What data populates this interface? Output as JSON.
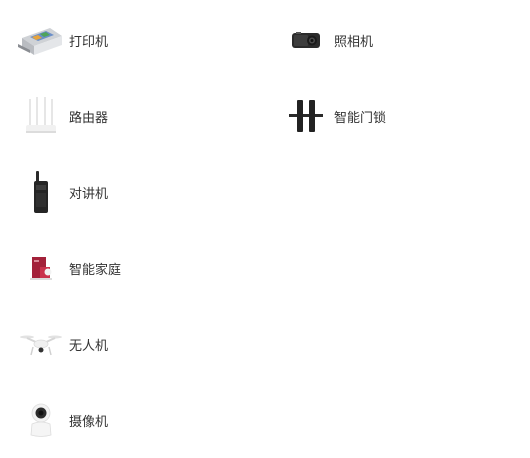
{
  "categories": [
    {
      "label": "打印机",
      "icon": "printer-icon"
    },
    {
      "label": "照相机",
      "icon": "camera-icon"
    },
    {
      "label": "路由器",
      "icon": "router-icon"
    },
    {
      "label": "智能门锁",
      "icon": "smart-lock-icon"
    },
    {
      "label": "对讲机",
      "icon": "walkie-talkie-icon"
    },
    {
      "label": "智能家庭",
      "icon": "smart-home-icon"
    },
    {
      "label": "无人机",
      "icon": "drone-icon"
    },
    {
      "label": "摄像机",
      "icon": "security-camera-icon"
    }
  ],
  "colors": {
    "text": "#333333",
    "background": "#ffffff",
    "accent_red": "#b3263a"
  }
}
